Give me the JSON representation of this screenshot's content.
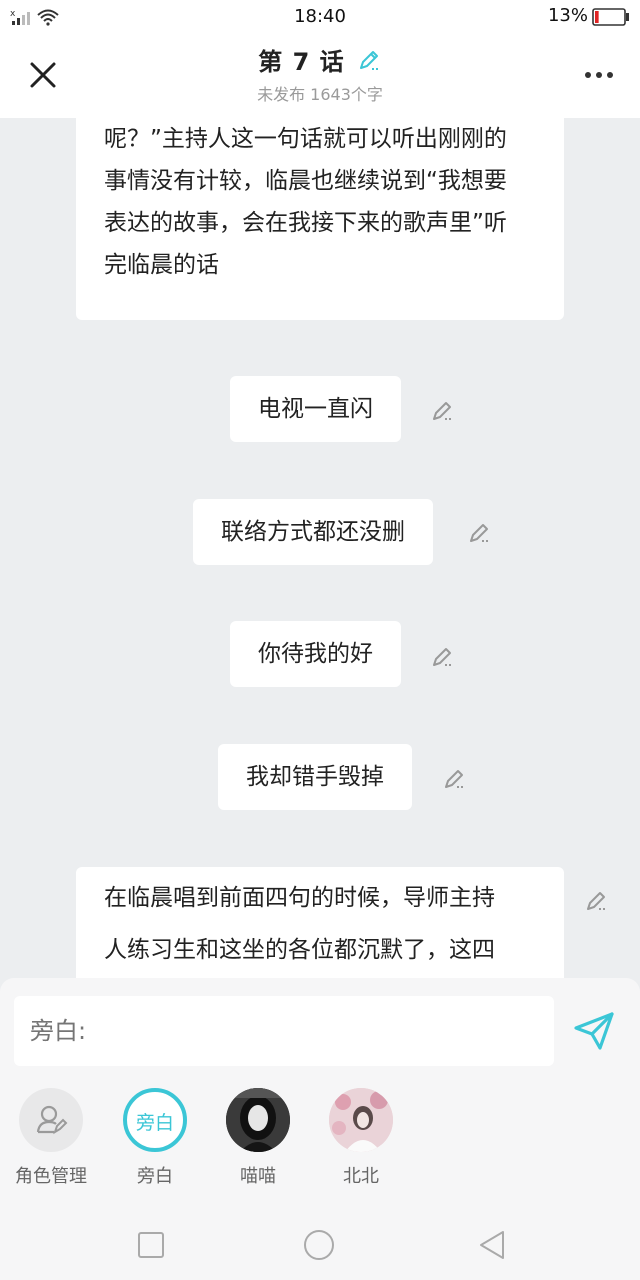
{
  "status_bar": {
    "time": "18:40",
    "battery_percent": "13%",
    "battery_level": 0.13,
    "signal_icon": "signal-icon",
    "wifi_icon": "wifi-icon",
    "battery_icon": "battery-icon"
  },
  "header": {
    "title": "第 7 话",
    "subtitle": "未发布 1643个字",
    "close_icon": "close-icon",
    "more_icon": "more-icon",
    "edit_icon": "edit-pencil-icon"
  },
  "messages": [
    {
      "type": "narration",
      "lines": [
        "呢？”主持人这一句话就可以听出刚刚的",
        "事情没有计较，临晨也继续说到“我想要",
        "表达的故事，会在我接下来的歌声里”听",
        "完临晨的话"
      ]
    },
    {
      "type": "line",
      "text": "电视一直闪"
    },
    {
      "type": "line",
      "text": "联络方式都还没删"
    },
    {
      "type": "line",
      "text": "你待我的好"
    },
    {
      "type": "line",
      "text": "我却错手毁掉"
    },
    {
      "type": "narration",
      "lines": [
        "在临晨唱到前面四句的时候，导师主持",
        "人练习生和这坐的各位都沉默了，这四"
      ]
    }
  ],
  "composer": {
    "placeholder": "旁白:",
    "send_icon": "send-icon",
    "accent_color": "#3bc6d6",
    "roles": [
      {
        "label": "角色管理",
        "icon": "role-manage-icon"
      },
      {
        "label": "旁白",
        "badge": "旁白",
        "selected": true
      },
      {
        "label": "喵喵"
      },
      {
        "label": "北北"
      }
    ]
  },
  "navbar": {
    "icons": [
      "square-icon",
      "circle-icon",
      "back-triangle-icon"
    ]
  }
}
